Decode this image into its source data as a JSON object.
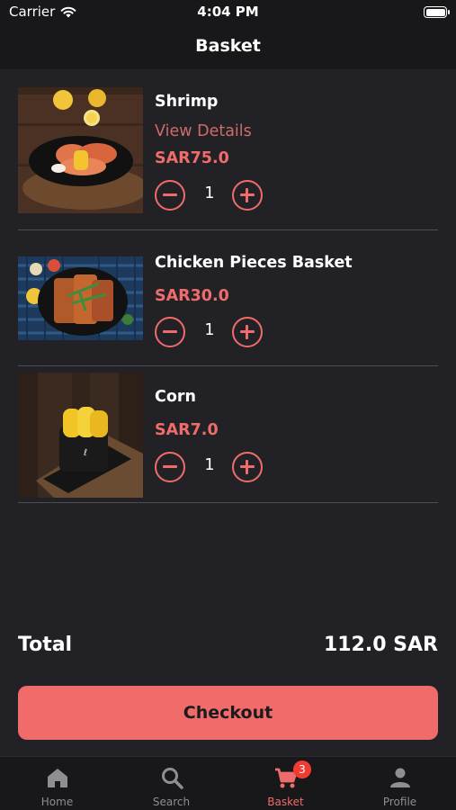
{
  "status_bar": {
    "carrier": "Carrier",
    "time": "4:04 PM"
  },
  "header": {
    "title": "Basket"
  },
  "basket": {
    "items": [
      {
        "name": "Shrimp",
        "details_link": "View Details",
        "price": "SAR75.0",
        "quantity": "1"
      },
      {
        "name": "Chicken Pieces Basket",
        "price": "SAR30.0",
        "quantity": "1"
      },
      {
        "name": "Corn",
        "price": "SAR7.0",
        "quantity": "1"
      }
    ]
  },
  "summary": {
    "total_label": "Total",
    "total_value": "112.0 SAR"
  },
  "checkout": {
    "label": "Checkout"
  },
  "tabs": [
    {
      "label": "Home",
      "icon": "home-icon"
    },
    {
      "label": "Search",
      "icon": "search-icon"
    },
    {
      "label": "Basket",
      "icon": "cart-icon",
      "badge": "3",
      "active": true
    },
    {
      "label": "Profile",
      "icon": "person-icon"
    }
  ],
  "colors": {
    "accent": "#f06c6c",
    "background": "#222226",
    "bar": "#18181a",
    "badge": "#f23c32"
  }
}
